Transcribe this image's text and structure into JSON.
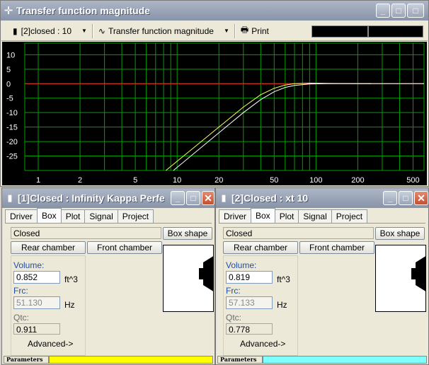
{
  "main_window": {
    "title": "Transfer function magnitude",
    "project_selector": "[2]closed : 10",
    "graph_selector": "Transfer function magnitude",
    "print_label": "Print"
  },
  "chart_data": {
    "type": "line",
    "x_scale": "log",
    "xlim": [
      0.8,
      600
    ],
    "ylim": [
      -30,
      14
    ],
    "x_ticks": [
      1,
      2,
      5,
      10,
      20,
      50,
      100,
      200,
      500
    ],
    "y_ticks": [
      10,
      5,
      0,
      -5,
      -10,
      -15,
      -20,
      -25
    ],
    "grid": true,
    "series": [
      {
        "color": "#ff2020",
        "x": [
          0.8,
          600
        ],
        "y": [
          0,
          0
        ]
      },
      {
        "color": "#ffff60",
        "x": [
          8.3,
          20,
          30,
          40,
          50,
          60,
          70,
          90,
          120,
          250
        ],
        "y": [
          -30,
          -15,
          -8.1,
          -3.8,
          -1.6,
          -0.5,
          0,
          0.2,
          0.1,
          0
        ]
      },
      {
        "color": "#ffffff",
        "x": [
          9.4,
          20,
          30,
          40,
          50,
          60,
          70,
          90,
          120,
          250,
          600
        ],
        "y": [
          -30,
          -17,
          -10,
          -5.5,
          -2.8,
          -1.3,
          -0.6,
          -0.1,
          0,
          0,
          0
        ]
      }
    ]
  },
  "windows": [
    {
      "title": "[1]Closed : Infinity Kappa Perfe...",
      "tabs": [
        "Driver",
        "Box",
        "Plot",
        "Signal",
        "Project"
      ],
      "box_type": "Closed",
      "box_shape_label": "Box shape",
      "rear_chamber_label": "Rear chamber",
      "front_chamber_label": "Front chamber",
      "volume_label": "Volume:",
      "volume_value": "0.852",
      "volume_unit": "ft^3",
      "frc_label": "Frc:",
      "frc_value": "51.130",
      "frc_unit": "Hz",
      "qtc_label": "Qtc:",
      "qtc_value": "0.911",
      "advanced_label": "Advanced->",
      "status_label": "Parameters",
      "status_color": "#ffff00"
    },
    {
      "title": "[2]Closed : xt 10",
      "tabs": [
        "Driver",
        "Box",
        "Plot",
        "Signal",
        "Project"
      ],
      "box_type": "Closed",
      "box_shape_label": "Box shape",
      "rear_chamber_label": "Rear chamber",
      "front_chamber_label": "Front chamber",
      "volume_label": "Volume:",
      "volume_value": "0.819",
      "volume_unit": "ft^3",
      "frc_label": "Frc:",
      "frc_value": "57.133",
      "frc_unit": "Hz",
      "qtc_label": "Qtc:",
      "qtc_value": "0.778",
      "advanced_label": "Advanced->",
      "status_label": "Parameters",
      "status_color": "#80ffff"
    }
  ]
}
